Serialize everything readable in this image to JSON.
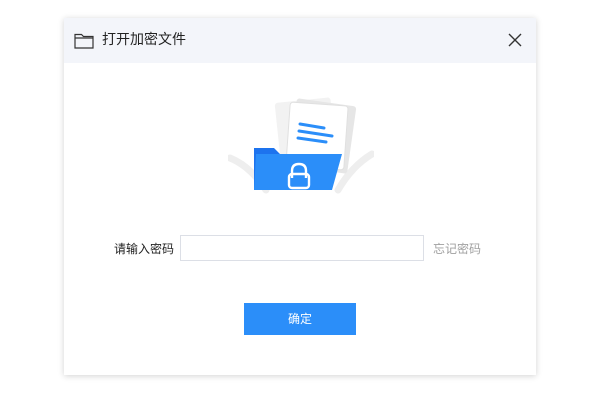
{
  "dialog": {
    "title": "打开加密文件",
    "title_icon": "folder-outline-icon",
    "close_icon": "close-icon",
    "illustration_icon": "encrypted-folder-icon"
  },
  "form": {
    "password_label": "请输入密码",
    "password_value": "",
    "password_placeholder": "",
    "forgot_password_label": "忘记密码"
  },
  "actions": {
    "confirm_label": "确定"
  },
  "colors": {
    "accent": "#2b8ef9",
    "titlebar_bg": "#f3f5fa",
    "muted_text": "#a0a0a0"
  }
}
